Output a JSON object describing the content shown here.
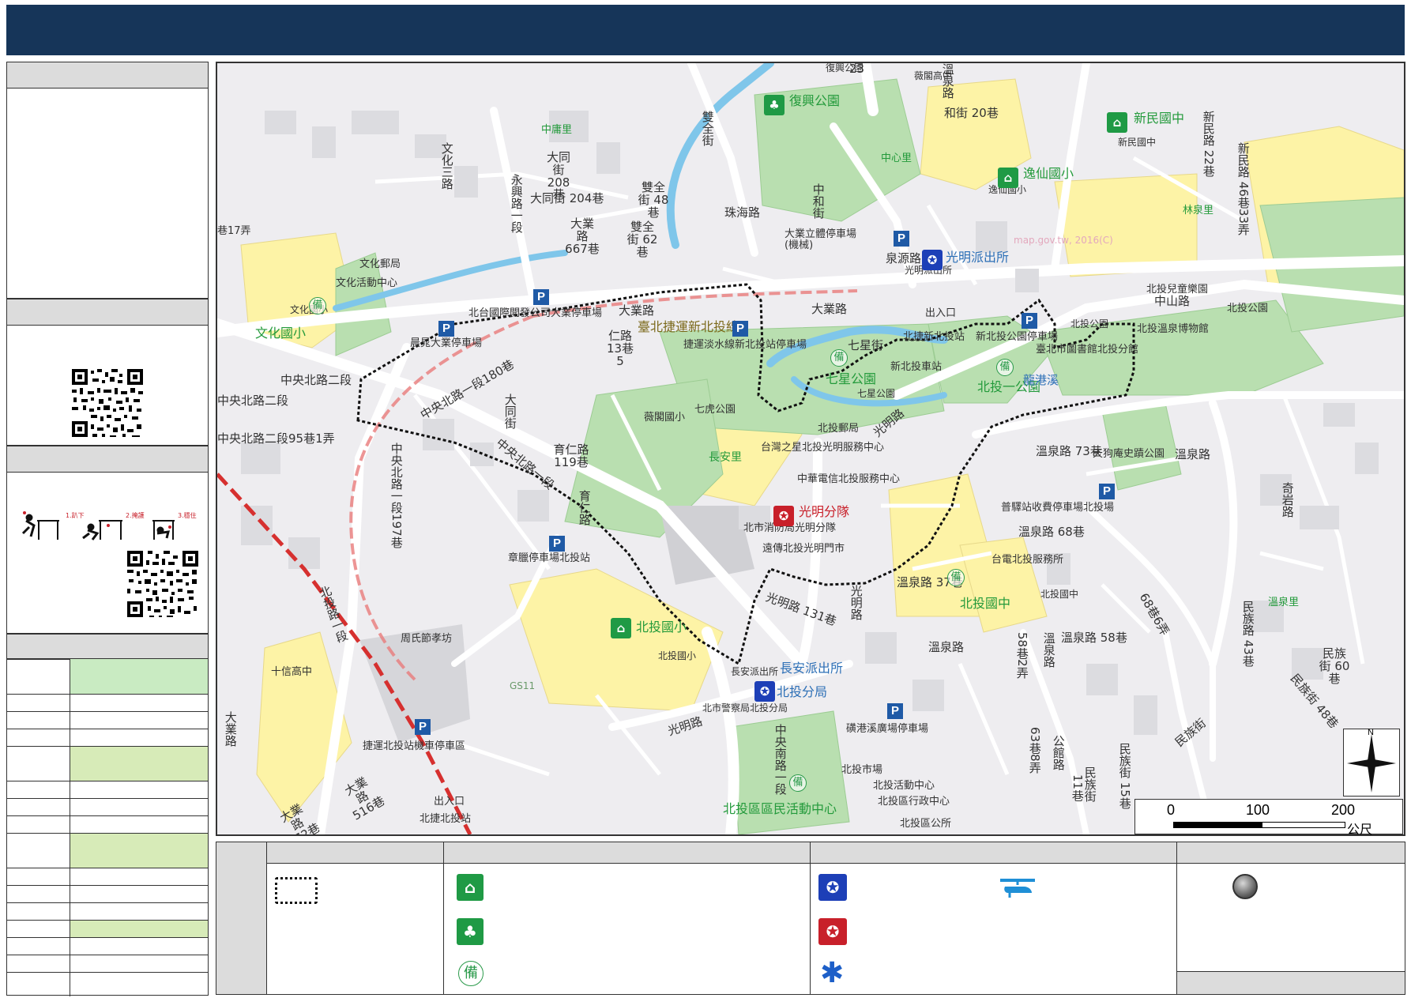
{
  "map": {
    "labels": {
      "fuxing_park": "復興公園",
      "fuxing_park_top": "復興公園",
      "weige_hs": "薇閣高中",
      "hejie_20": "和街 20巷",
      "xinmin_jh": "新民國中",
      "xinmin_jh_small": "新民國中",
      "xinmin_rd_22": "新民路 22巷",
      "xinmin_rd_46_33": "新民路 46巷33弄",
      "zhongyong_li": "中庸里",
      "datong_208": "大同街 208巷",
      "datong_204": "大同街 204巷",
      "shuangquan_48": "雙全街 48巷",
      "shuangquan_62": "雙全街 62巷",
      "daye_667": "大業路 667巷",
      "zhongxin_li": "中心里",
      "yixian_es": "逸仙國小",
      "yixian_es_small": "逸仙國小",
      "linquan_li": "林泉里",
      "zhuhai_rd": "珠海路",
      "zhonghe_st": "中和街",
      "daye_parking": "大業立體停車場 (機械)",
      "quanyuan_rd": "泉源路",
      "guangming_station": "光明派出所",
      "guangming_station_small": "光明派出所",
      "beitou_childrens_park": "北投兒童樂園",
      "zhongshan_rd": "中山路",
      "beitou_park_right": "北投公園",
      "beitou_hot_spring_museum": "北投溫泉博物館",
      "taipei_library": "臺北市圖書館北投分館",
      "beitou_park_top": "北投公園",
      "wenhua_post": "文化郵局",
      "wenhua_center": "文化活動中心",
      "wenhua_es": "文化國小",
      "wenhua_es_small": "文化國小",
      "jingyuan_parking": "晨晁大業停車場",
      "beitai_parking": "北台國際開發公司大業停車場",
      "daye_rd_a": "大業路",
      "daye_rd_b": "大業路",
      "mrt_xinbeitou_line": "臺北捷運新北投線",
      "exit_a": "出入口",
      "mrt_parking": "捷運淡水線新北投站停車場",
      "qixing_st": "七星街",
      "xinbeitou_mrt": "北捷新北投站",
      "xinbeitou_station": "新北投車站",
      "qixing_park": "七星公園",
      "qixing_park_small": "七星公園",
      "xinbeitou_parking": "新北投公園停車場",
      "beitou_1_park": "北投一公園",
      "longhu_pond": "龍港溪",
      "zhongyang_n_rd_2": "中央北路二段",
      "zhongyang_2_95_1": "中央北路二段95巷1弄",
      "zhongyang_1_180": "中央北路一段180巷",
      "datong_st": "大同街",
      "renai_13_5": "仁路 13巷 5",
      "weige_es": "薇閣國小",
      "qihu_park": "七虎公園",
      "changan_li": "長安里",
      "beitou_post": "北投郵局",
      "guangming_rd": "光明路",
      "taiwan_water": "台灣之星北投光明服務中心",
      "chunghwa": "中華電信北投服務中心",
      "wenquan_73": "溫泉路 73巷",
      "tiangou_park": "天狗庵史蹟公園",
      "wenquan_rd": "溫泉路",
      "qiyan_rd": "奇岩路",
      "guangming_squad": "光明分隊",
      "fire_bureau": "北市消防局光明分隊",
      "yuanchuan": "遠傳北投光明門市",
      "toll_parking": "普驛站收費停車場北投場",
      "wenquan_68": "溫泉路 68巷",
      "zhongyang_n_1": "中央北路一段",
      "yuren_119": "育仁路 119巷",
      "yuren_rd": "育仁路",
      "zhongyang_197": "中央北路一段197巷",
      "zhanglin_parking": "章臘停車場北投站",
      "taipower": "台電北投服務所",
      "beitou_jh": "北投國中",
      "beitou_jh_small": "北投國中",
      "wenquan_37": "溫泉路 37巷",
      "guangming_131": "光明路 131巷",
      "guangming_rd2": "光明路",
      "wenquan_li": "溫泉里",
      "minzu_43": "民族路 43巷",
      "wenquan_68_6": "68巷6弄",
      "wenquan_58": "溫泉路 58巷",
      "wenquan_58_2": "58巷2弄",
      "wenquan_rd3": "溫泉路",
      "minzu_60": "民族街 60巷",
      "minzu_48": "民族街 48巷",
      "minzu_st": "民族街",
      "beitou_es": "北投國小",
      "beitou_es_small": "北投國小",
      "zhoushi": "周氏節孝坊",
      "beitou_rd_1": "北投路一段",
      "shixin_hs": "十信高中",
      "gs11": "GS11",
      "changan_station": "長安派出所",
      "changan_station_small": "長安派出所",
      "beitou_police": "北投分局",
      "beitou_police_small": "北市警察局北投分局",
      "guangming_rd3": "光明路",
      "zhongyang_s_1": "中央南路一段",
      "xiliao_parking": "磺港溪廣場停車場",
      "mrt_beitou_parking": "捷運北投站機車停車區",
      "daye_rd_c": "大業路",
      "daye_516": "大業路 516巷",
      "daye_472": "大業路 472巷",
      "exit_b": "出入口",
      "beitou_mrt": "北捷北投站",
      "beitou_market": "北投市場",
      "beitou_civic": "北投活動中心",
      "beitou_admin": "北投區行政中心",
      "beitou_district_center": "北投區區民活動中心",
      "beitou_office": "北投區公所",
      "gongguan_rd": "公館路",
      "minzu_st2": "民族街",
      "wenquan_63_8": "63巷8弄",
      "alley_11": "11巷",
      "minzu_15": "民族街 15巷",
      "rd_23": "23",
      "watermark": "map.gov.tw, 2016(C)"
    }
  },
  "scale": {
    "tick0": "0",
    "tick1": "100",
    "tick2": "200",
    "unit": "公尺"
  },
  "north": {
    "label": "N"
  },
  "icons": {
    "p": "P",
    "reserve": "備",
    "park_icon": "park-icon",
    "school_icon": "school-icon",
    "police_icon": "police-icon",
    "fire_icon": "fire-icon",
    "medical_icon": "medical-icon",
    "helicopter_icon": "helicopter-icon",
    "circle_icon": "circle-icon",
    "qr_icon": "qr-code-icon"
  },
  "colors": {
    "header": "#163559",
    "school_fill": "#fdf3a6",
    "park_fill": "#b9dfb0",
    "water": "#7fc6ea",
    "green_icon": "#1f9a45",
    "police_blue": "#1d3fb7",
    "fire_red": "#c8202a",
    "table_green": "#c9ebc2",
    "table_green2": "#d7ebb8"
  }
}
